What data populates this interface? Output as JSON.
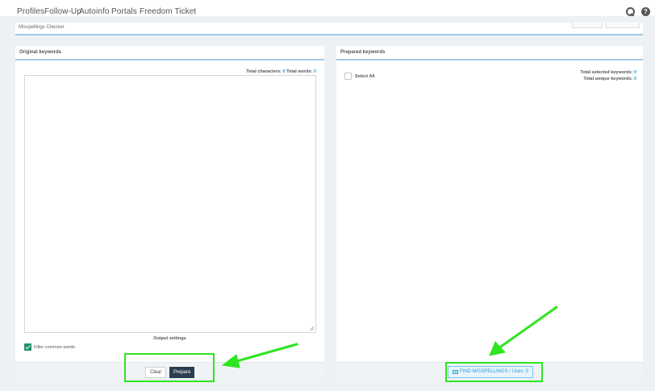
{
  "nav": {
    "items": [
      "Profiles",
      "Follow-Up",
      "Autoinfo",
      "Portals",
      "Freedom Ticket"
    ]
  },
  "checker": {
    "title": "Misspellings Checker"
  },
  "left_panel": {
    "title": "Original keywords",
    "counts_chars_label": "Total characters:",
    "counts_chars_value": "0",
    "counts_words_label": "Total words:",
    "counts_words_value": "0",
    "textarea_value": "",
    "output_settings_label": "Output settings",
    "filter_label": "Filter common words",
    "filter_checked": true,
    "clear_label": "Clear",
    "prepare_label": "Prepare"
  },
  "right_panel": {
    "title": "Prepared keywords",
    "select_all_label": "Select All",
    "selected_label": "Total selected keywords:",
    "selected_value": "0",
    "unique_label": "Total unique keywords:",
    "unique_value": "0",
    "find_label": "FIND MISSPELLINGS / Uses: 0"
  },
  "colors": {
    "accent": "#2e9ad6",
    "primary_button": "#2d3e50",
    "check": "#1f8f6e",
    "annotation": "#2ee51f"
  }
}
